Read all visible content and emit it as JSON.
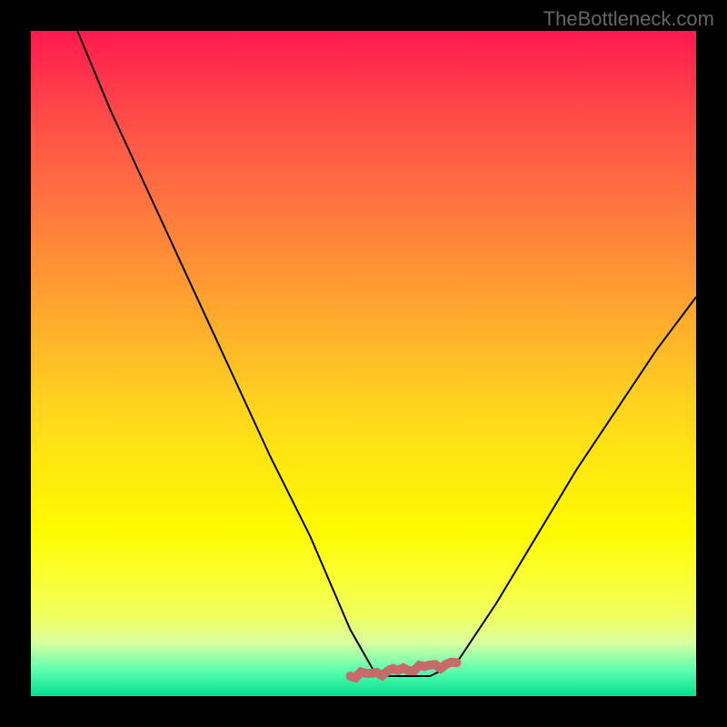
{
  "watermark": "TheBottleneck.com",
  "chart_data": {
    "type": "line",
    "title": "",
    "xlabel": "",
    "ylabel": "",
    "xlim": [
      0,
      1
    ],
    "ylim": [
      0,
      1
    ],
    "grid": false,
    "background": "heatmap-gradient",
    "background_gradient": {
      "direction": "vertical",
      "stops": [
        {
          "pos": 0.0,
          "color": "#ff1a50"
        },
        {
          "pos": 0.5,
          "color": "#ffd020"
        },
        {
          "pos": 0.8,
          "color": "#fffa00"
        },
        {
          "pos": 1.0,
          "color": "#00e090"
        }
      ]
    },
    "series": [
      {
        "name": "bottleneck-curve",
        "color": "#000000",
        "x": [
          0.07,
          0.12,
          0.18,
          0.24,
          0.3,
          0.36,
          0.42,
          0.48,
          0.52,
          0.56,
          0.6,
          0.64,
          0.7,
          0.76,
          0.82,
          0.88,
          0.94,
          1.0
        ],
        "y": [
          1.0,
          0.88,
          0.75,
          0.62,
          0.49,
          0.36,
          0.24,
          0.1,
          0.03,
          0.03,
          0.03,
          0.05,
          0.14,
          0.24,
          0.34,
          0.43,
          0.52,
          0.6
        ]
      },
      {
        "name": "optimal-zone-marker",
        "color": "#cc6666",
        "style": "thick-noisy",
        "x": [
          0.48,
          0.64
        ],
        "y": [
          0.03,
          0.05
        ]
      }
    ],
    "annotations": [
      {
        "text": "TheBottleneck.com",
        "position": "top-right",
        "color": "#666666"
      }
    ]
  }
}
